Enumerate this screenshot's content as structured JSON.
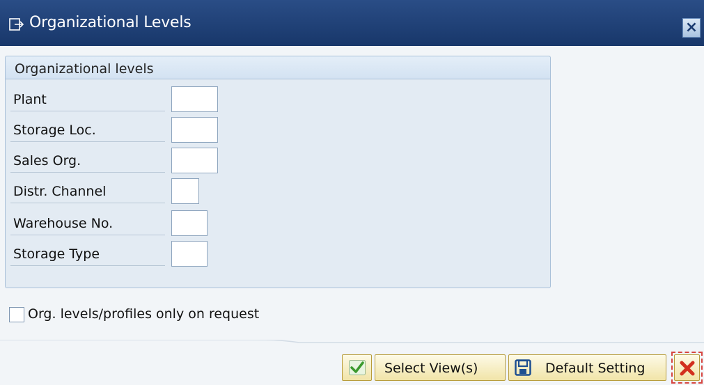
{
  "window": {
    "title": "Organizational Levels",
    "close_icon": "close-icon"
  },
  "group": {
    "title": "Organizational levels",
    "fields": [
      {
        "label": "Plant",
        "value": ""
      },
      {
        "label": "Storage Loc.",
        "value": ""
      },
      {
        "label": "Sales Org.",
        "value": ""
      },
      {
        "label": "Distr. Channel",
        "value": ""
      },
      {
        "label": "Warehouse No.",
        "value": ""
      },
      {
        "label": "Storage Type",
        "value": ""
      }
    ]
  },
  "checkbox": {
    "label": "Org. levels/profiles only on request",
    "checked": false
  },
  "buttons": {
    "ok_icon": "checkmark-icon",
    "select_views_label": "Select View(s)",
    "default_setting_icon": "save-icon",
    "default_setting_label": "Default Setting",
    "cancel_icon": "cancel-icon"
  },
  "colors": {
    "titlebar": "#1f4178",
    "button_bg": "#f5ecc0",
    "accent_green": "#3c9a2e",
    "accent_red": "#d64541"
  }
}
